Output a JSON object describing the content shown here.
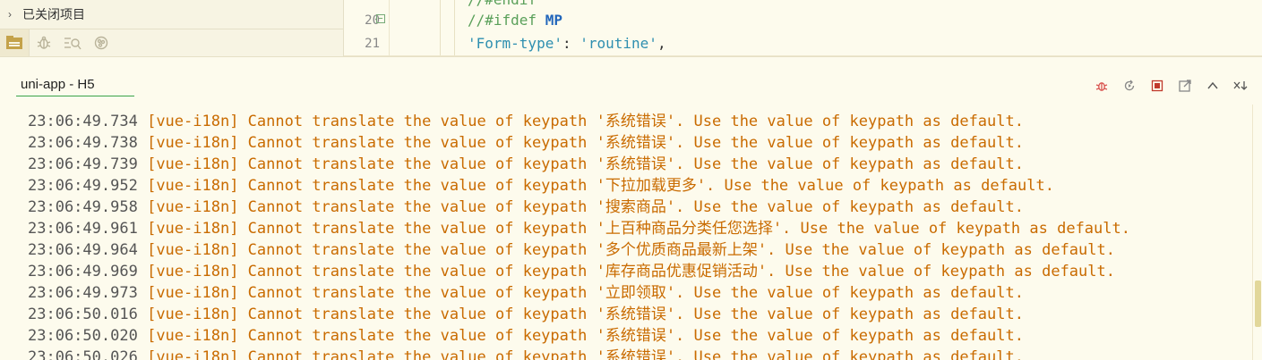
{
  "sidebar": {
    "tree_item": "已关闭项目",
    "tabs": [
      {
        "icon": "project-manager-icon",
        "active": true
      },
      {
        "icon": "debug-bug-icon",
        "active": false
      },
      {
        "icon": "search-list-icon",
        "active": false
      },
      {
        "icon": "plugin-icon",
        "active": false
      }
    ]
  },
  "editor": {
    "lines": [
      {
        "number": "",
        "text": "//#endif"
      },
      {
        "number": "20",
        "comment": "//#ifdef ",
        "keyword": "MP"
      },
      {
        "number": "21",
        "key": "'Form-type'",
        "sep": ": ",
        "value": "'routine'",
        "tail": ","
      }
    ]
  },
  "console": {
    "tab_label": "uni-app - H5",
    "toolbar": [
      {
        "name": "debug-icon",
        "color": "#d9534f"
      },
      {
        "name": "restart-icon",
        "color": "#888888"
      },
      {
        "name": "stop-icon",
        "color": "#c0392b"
      },
      {
        "name": "open-external-icon",
        "color": "#888888"
      },
      {
        "name": "collapse-up-icon",
        "color": "#555555"
      },
      {
        "name": "clear-console-icon",
        "color": "#555555"
      }
    ],
    "logs": [
      {
        "time": "23:06:49.734",
        "text": "[vue-i18n] Cannot translate the value of keypath '系统错误'. Use the value of keypath as default."
      },
      {
        "time": "23:06:49.738",
        "text": "[vue-i18n] Cannot translate the value of keypath '系统错误'. Use the value of keypath as default."
      },
      {
        "time": "23:06:49.739",
        "text": "[vue-i18n] Cannot translate the value of keypath '系统错误'. Use the value of keypath as default."
      },
      {
        "time": "23:06:49.952",
        "text": "[vue-i18n] Cannot translate the value of keypath '下拉加载更多'. Use the value of keypath as default."
      },
      {
        "time": "23:06:49.958",
        "text": "[vue-i18n] Cannot translate the value of keypath '搜索商品'. Use the value of keypath as default."
      },
      {
        "time": "23:06:49.961",
        "text": "[vue-i18n] Cannot translate the value of keypath '上百种商品分类任您选择'. Use the value of keypath as default."
      },
      {
        "time": "23:06:49.964",
        "text": "[vue-i18n] Cannot translate the value of keypath '多个优质商品最新上架'. Use the value of keypath as default."
      },
      {
        "time": "23:06:49.969",
        "text": "[vue-i18n] Cannot translate the value of keypath '库存商品优惠促销活动'. Use the value of keypath as default."
      },
      {
        "time": "23:06:49.973",
        "text": "[vue-i18n] Cannot translate the value of keypath '立即领取'. Use the value of keypath as default."
      },
      {
        "time": "23:06:50.016",
        "text": "[vue-i18n] Cannot translate the value of keypath '系统错误'. Use the value of keypath as default."
      },
      {
        "time": "23:06:50.020",
        "text": "[vue-i18n] Cannot translate the value of keypath '系统错误'. Use the value of keypath as default."
      },
      {
        "time": "23:06:50.026",
        "text": "[vue-i18n] Cannot translate the value of keypath '系统错误'. Use the value of keypath as default."
      }
    ]
  },
  "colors": {
    "background": "#fdfbed",
    "log_message": "#c96b00",
    "timestamp": "#555555",
    "tab_underline": "#3aa34a"
  }
}
